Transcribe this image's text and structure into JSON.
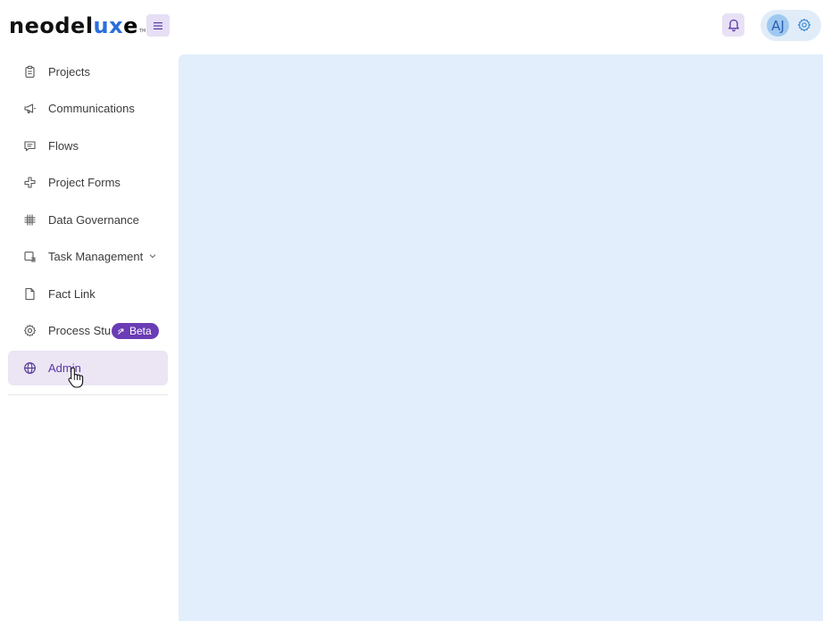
{
  "brand": {
    "logo_part1": "neode",
    "logo_part2": "l",
    "logo_part3": "ux",
    "logo_part4": "e",
    "logo_tm": "TM"
  },
  "header": {
    "user_initials": "AJ"
  },
  "sidebar": {
    "items": [
      {
        "label": "Projects",
        "icon": "clipboard-icon"
      },
      {
        "label": "Communications",
        "icon": "megaphone-icon"
      },
      {
        "label": "Flows",
        "icon": "message-icon"
      },
      {
        "label": "Project Forms",
        "icon": "puzzle-icon"
      },
      {
        "label": "Data Governance",
        "icon": "grid-hash-icon"
      },
      {
        "label": "Task Management",
        "icon": "task-icon"
      },
      {
        "label": "Fact Link",
        "icon": "file-icon"
      },
      {
        "label": "Process Stu",
        "icon": "gear-icon"
      },
      {
        "label": "Admin",
        "icon": "globe-icon"
      }
    ],
    "beta_badge": "Beta",
    "active_item": "Admin"
  },
  "colors": {
    "accent": "#6a3cb5",
    "active_bg": "#ebe5f4",
    "main_bg": "#e2eefb",
    "logo_ux": "#2a6fdb"
  }
}
